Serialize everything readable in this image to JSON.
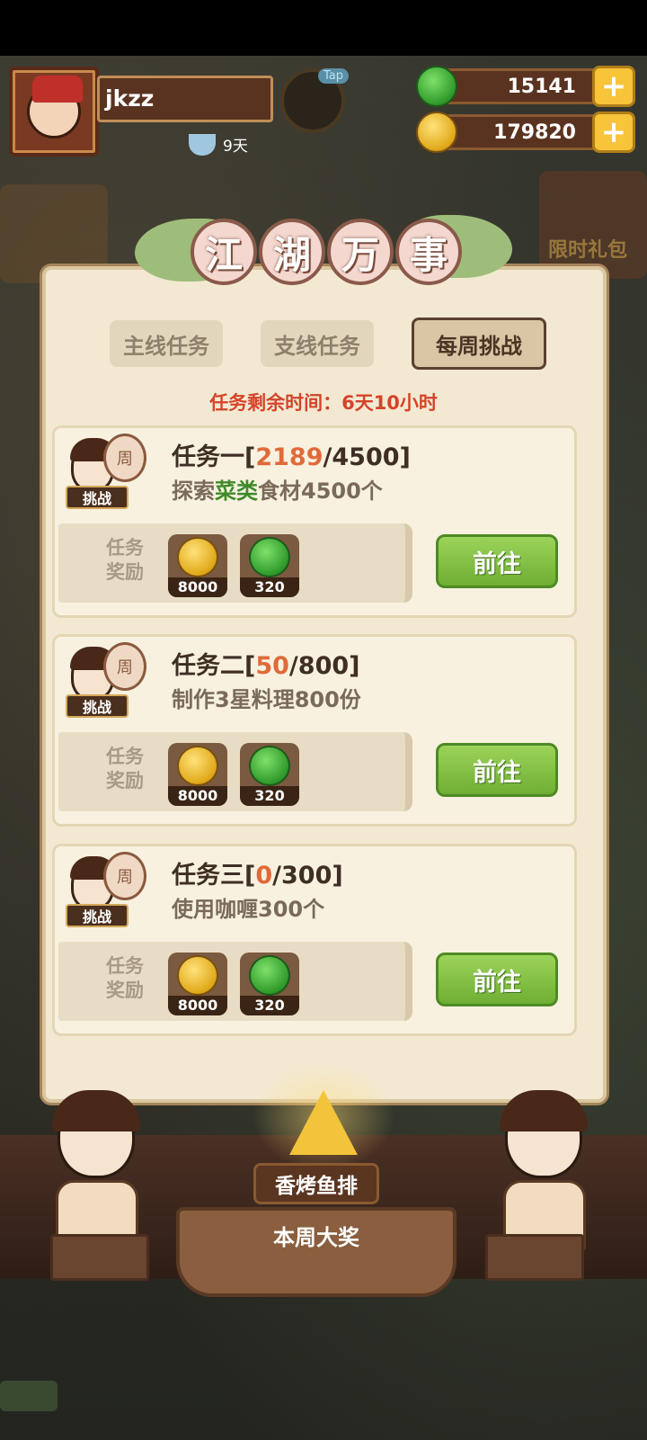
{
  "header": {
    "username": "jkzz",
    "tap_label": "Tap",
    "days": "9天",
    "jade": "15141",
    "coins": "179820",
    "plus": "+"
  },
  "side": {
    "right_promo": "限时礼包"
  },
  "panel": {
    "title_chars": [
      "江",
      "湖",
      "万",
      "事"
    ],
    "tabs": [
      "主线任务",
      "支线任务",
      "每周挑战"
    ],
    "active_tab": "每周挑战",
    "time_label": "任务剩余时间：",
    "time_value": "6天10小时",
    "badge_zhou": "周",
    "badge_label": "挑战",
    "reward_label_1": "任务",
    "reward_label_2": "奖励",
    "go_label": "前往"
  },
  "tasks": [
    {
      "name": "任务一",
      "current": "2189",
      "target": "4500",
      "desc_pre": "探索",
      "desc_hl": "菜类",
      "desc_post": "食材4500个",
      "reward_coin": "8000",
      "reward_jade": "320"
    },
    {
      "name": "任务二",
      "current": "50",
      "target": "800",
      "desc_pre": "制作3星料理800份",
      "desc_hl": "",
      "desc_post": "",
      "reward_coin": "8000",
      "reward_jade": "320"
    },
    {
      "name": "任务三",
      "current": "0",
      "target": "300",
      "desc_pre": "使用咖喱300个",
      "desc_hl": "",
      "desc_post": "",
      "reward_coin": "8000",
      "reward_jade": "320"
    }
  ],
  "prize": {
    "name": "香烤鱼排",
    "label": "本周大奖"
  },
  "colors": {
    "accent_red": "#d5432a",
    "progress_orange": "#e06a3a",
    "go_green": "#6fae34"
  }
}
